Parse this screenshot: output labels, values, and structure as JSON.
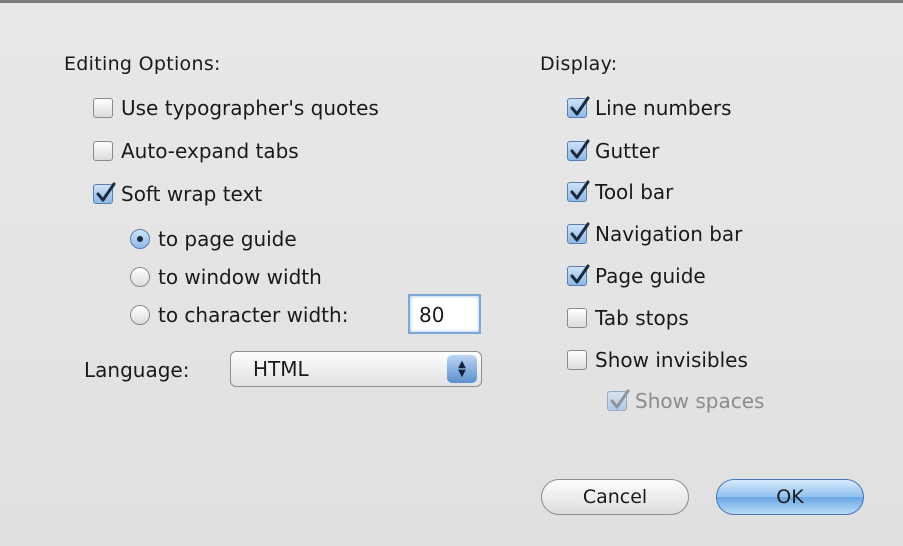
{
  "editing": {
    "title": "Editing Options:",
    "options": [
      {
        "label": "Use typographer's quotes",
        "checked": false
      },
      {
        "label": "Auto-expand tabs",
        "checked": false
      },
      {
        "label": "Soft wrap text",
        "checked": true
      }
    ],
    "wrap_modes": [
      {
        "label": "to page guide",
        "selected": true
      },
      {
        "label": "to window width",
        "selected": false
      },
      {
        "label": "to character width:",
        "selected": false
      }
    ],
    "character_width_value": "80",
    "language_label": "Language:",
    "language_value": "HTML"
  },
  "display": {
    "title": "Display:",
    "options": [
      {
        "label": "Line numbers",
        "checked": true
      },
      {
        "label": "Gutter",
        "checked": true
      },
      {
        "label": "Tool bar",
        "checked": true
      },
      {
        "label": "Navigation bar",
        "checked": true
      },
      {
        "label": "Page guide",
        "checked": true
      },
      {
        "label": "Tab stops",
        "checked": false
      },
      {
        "label": "Show invisibles",
        "checked": false
      },
      {
        "label": "Show spaces",
        "checked": true,
        "disabled": true
      }
    ]
  },
  "buttons": {
    "cancel": "Cancel",
    "ok": "OK"
  },
  "colors": {
    "accent": "#6aa7e4",
    "dialog_background": "#e3e3e3"
  }
}
